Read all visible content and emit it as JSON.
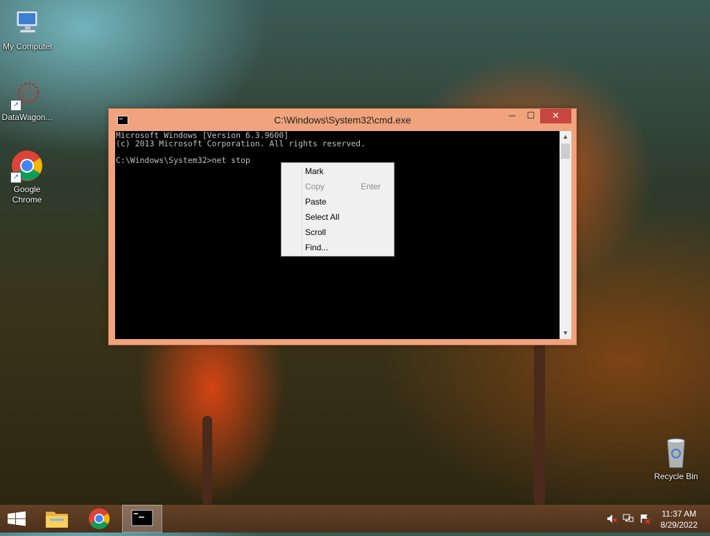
{
  "desktop": {
    "icons": [
      {
        "label": "My Computer"
      },
      {
        "label": "DataWagon..."
      },
      {
        "label": "Google Chrome"
      },
      {
        "label": "Recycle Bin"
      }
    ]
  },
  "window": {
    "title": "C:\\Windows\\System32\\cmd.exe",
    "controls": {
      "minimize": "─",
      "maximize": "☐",
      "close": "✕"
    },
    "console_lines": [
      "Microsoft Windows [Version 6.3.9600]",
      "(c) 2013 Microsoft Corporation. All rights reserved.",
      "",
      "C:\\Windows\\System32>net stop"
    ]
  },
  "context_menu": {
    "items": [
      {
        "label": "Mark",
        "shortcut": "",
        "enabled": true
      },
      {
        "label": "Copy",
        "shortcut": "Enter",
        "enabled": false
      },
      {
        "label": "Paste",
        "shortcut": "",
        "enabled": true
      },
      {
        "label": "Select All",
        "shortcut": "",
        "enabled": true
      },
      {
        "label": "Scroll",
        "shortcut": "",
        "enabled": true
      },
      {
        "label": "Find...",
        "shortcut": "",
        "enabled": true
      }
    ]
  },
  "taskbar": {
    "items": [
      {
        "icon": "file-explorer-icon"
      },
      {
        "icon": "chrome-icon"
      },
      {
        "icon": "cmd-icon",
        "active": true
      }
    ],
    "tray": {
      "icons": [
        "volume-muted-icon",
        "network-icon",
        "action-center-icon"
      ]
    },
    "clock": {
      "time": "11:37 AM",
      "date": "8/29/2022"
    }
  },
  "colors": {
    "window_frame": "#f0a37c",
    "close_button": "#c7463f",
    "console_bg": "#000000",
    "console_text": "#c0c0c0"
  }
}
